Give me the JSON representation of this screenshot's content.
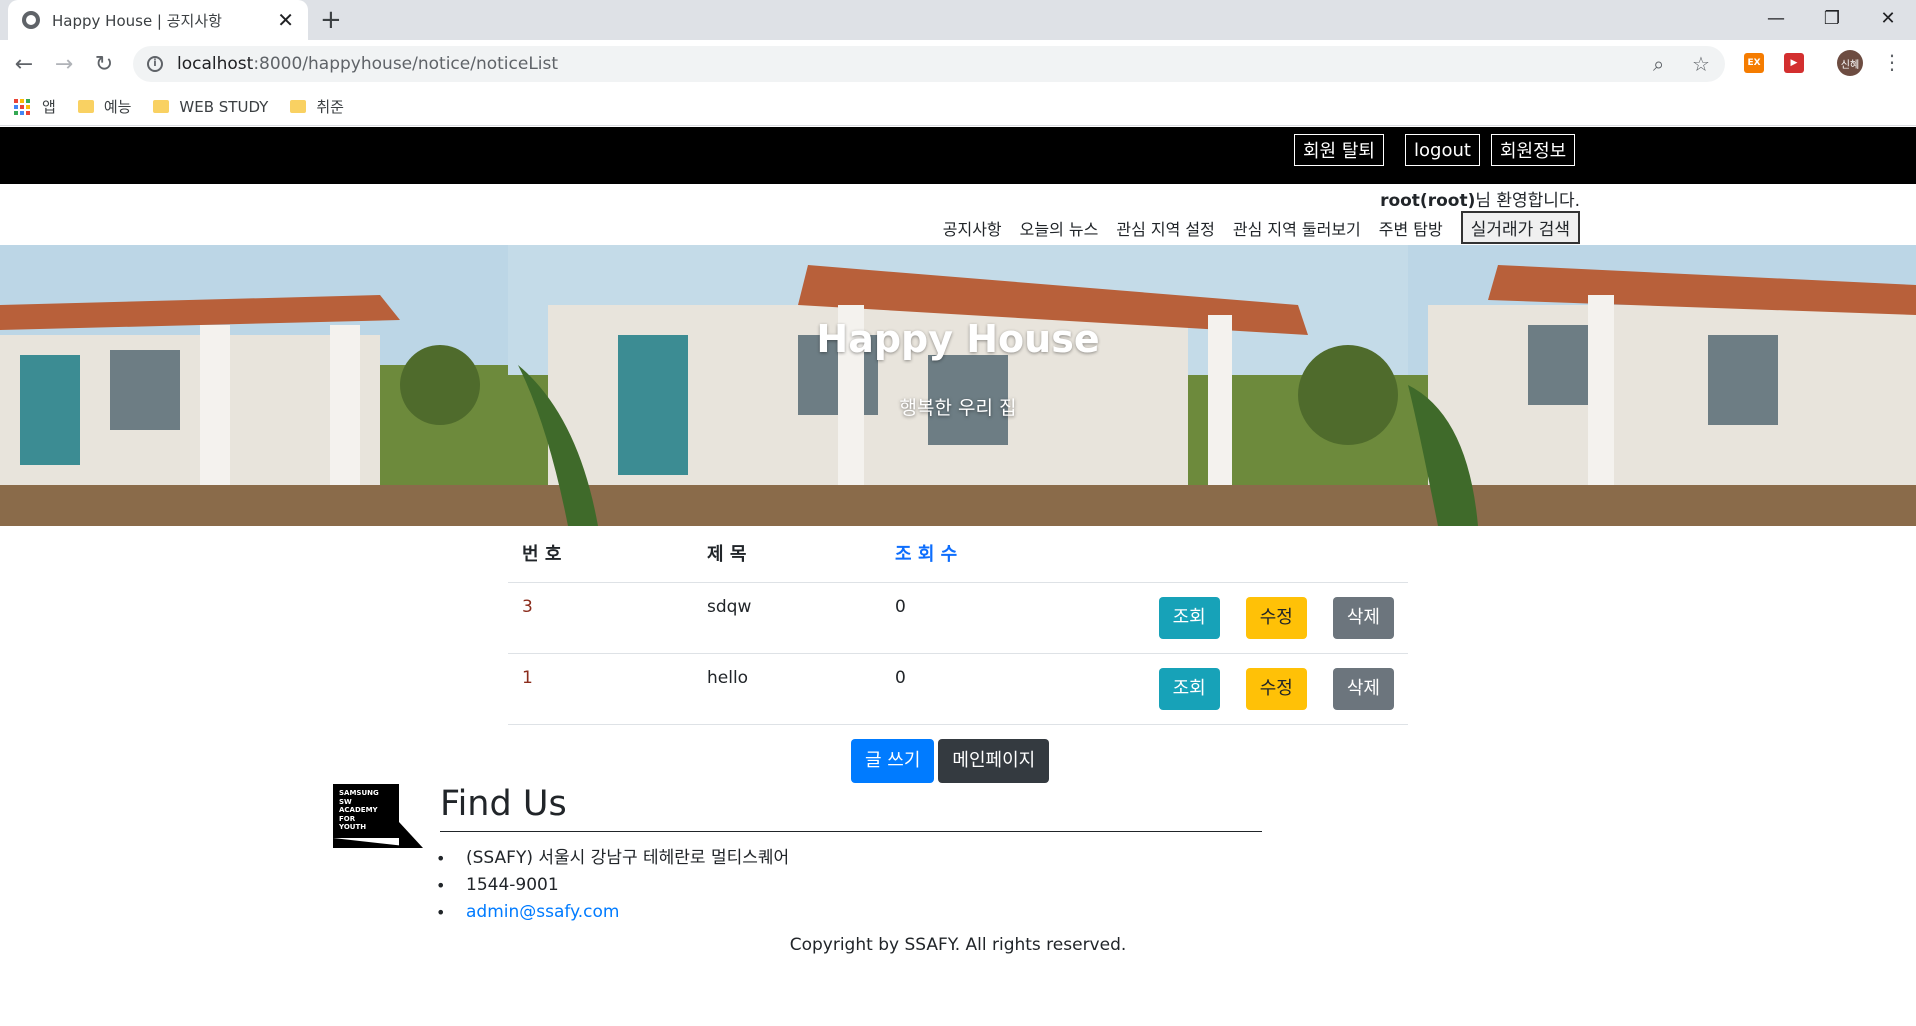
{
  "browser": {
    "tab_title": "Happy House | 공지사항",
    "tab_close": "✕",
    "new_tab": "+",
    "url_host": "localhost",
    "url_path": ":8000/happyhouse/notice/noticeList",
    "profile_label": "신혜",
    "ext1_label": "EX",
    "ext2_label": "▶",
    "bookmarks": [
      {
        "label": "앱",
        "icon": "apps-icon"
      },
      {
        "label": "예능",
        "icon": "folder-icon"
      },
      {
        "label": "WEB STUDY",
        "icon": "folder-icon"
      },
      {
        "label": "취준",
        "icon": "folder-icon"
      }
    ]
  },
  "header": {
    "withdraw_label": "회원 탈퇴",
    "logout_label": "logout",
    "member_info_label": "회원정보",
    "welcome_user": "root(root)",
    "welcome_text": "님 환영합니다."
  },
  "nav": {
    "items": [
      "공지사항",
      "오늘의 뉴스",
      "관심 지역 설정",
      "관심 지역 둘러보기",
      "주변 탐방"
    ],
    "search_label": "실거래가 검색"
  },
  "hero": {
    "title": "Happy House",
    "subtitle": "행복한 우리 집"
  },
  "table": {
    "headers": {
      "no": "번 호",
      "title": "제 목",
      "hits": "조 회 수"
    },
    "rows": [
      {
        "no": "3",
        "title": "sdqw",
        "hits": "0"
      },
      {
        "no": "1",
        "title": "hello",
        "hits": "0"
      }
    ],
    "view_label": "조회",
    "edit_label": "수정",
    "delete_label": "삭제"
  },
  "actions": {
    "write_label": "글 쓰기",
    "main_label": "메인페이지"
  },
  "footer": {
    "logo_lines": [
      "SAMSUNG",
      "SW",
      "ACADEMY",
      "FOR",
      "YOUTH"
    ],
    "find_us_title": "Find Us",
    "address": "(SSAFY) 서울시 강남구 테헤란로 멀티스퀘어",
    "phone": "1544-9001",
    "email": "admin@ssafy.com",
    "copyright": "Copyright by SSAFY. All rights reserved."
  },
  "colors": {
    "info": "#17a2b8",
    "warning": "#ffc107",
    "secondary": "#6c757d",
    "primary": "#007bff",
    "dark": "#343a40"
  }
}
